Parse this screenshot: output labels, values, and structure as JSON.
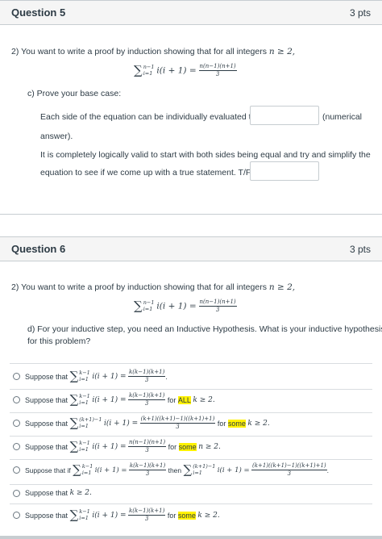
{
  "q5": {
    "title": "Question 5",
    "points": "3 pts",
    "prompt": "2) You want to write a proof by induction showing that for all integers",
    "prompt_cond": "n ≥ 2,",
    "formula_sum_upper": "n−1",
    "formula_sum_lower": "i=1",
    "formula_body": "i(i + 1) =",
    "formula_num": "n(n−1)(n+1)",
    "formula_den": "3",
    "part_label": "c) Prove your base case:",
    "line1": "Each side of the equation can be individually evaluated to",
    "line1_suffix": "(numerical",
    "line1_cont": "answer).",
    "line2": "It is completely logically valid to start with both sides being equal and try and simplify the",
    "line2_cont": "equation to see if we come up with a true statement.  T/F"
  },
  "q6": {
    "title": "Question 6",
    "points": "3 pts",
    "prompt": "2) You want to write a proof by induction showing that for all integers",
    "prompt_cond": "n ≥ 2,",
    "formula_sum_upper": "n−1",
    "formula_sum_lower": "i=1",
    "formula_body": "i(i + 1) =",
    "formula_num": "n(n−1)(n+1)",
    "formula_den": "3",
    "part_label": "d) For your inductive step, you need an Inductive Hypothesis.  What is your inductive hypothesis",
    "part_label_cont": "for this problem?",
    "options": [
      {
        "prefix": "Suppose that",
        "upper": "k−1",
        "lower": "i=1",
        "body": "i(i + 1) =",
        "num": "k(k−1)(k+1)",
        "den": "3",
        "tail": "."
      },
      {
        "prefix": "Suppose that",
        "upper": "k−1",
        "lower": "i=1",
        "body": "i(i + 1) =",
        "num": "k(k−1)(k+1)",
        "den": "3",
        "tail_pre": "for",
        "tail_hl": "ALL",
        "tail_post": "k ≥ 2."
      },
      {
        "prefix": "Suppose that",
        "upper": "(k+1)−1",
        "lower": "i=1",
        "body": "i(i + 1) =",
        "num": "(k+1)((k+1)−1)((k+1)+1)",
        "den": "3",
        "tail_pre": "for",
        "tail_hl": "some",
        "tail_post": "k ≥ 2."
      },
      {
        "prefix": "Suppose that",
        "upper": "k−1",
        "lower": "i=1",
        "body": "i(i + 1) =",
        "num": "n(n−1)(n+1)",
        "den": "3",
        "tail_pre": "for",
        "tail_hl": "some",
        "tail_post": "n ≥ 2."
      },
      {
        "prefix": "Suppose that if",
        "upper": "k−1",
        "lower": "i=1",
        "body": "i(i + 1) =",
        "num": "k(k−1)(k+1)",
        "den": "3",
        "mid": "then",
        "upper2": "(k+1)−1",
        "lower2": "i=1",
        "body2": "i(i + 1) =",
        "num2": "(k+1)((k+1)−1)((k+1)+1)",
        "den2": "3",
        "tail": "."
      },
      {
        "prefix": "Suppose that",
        "plain": "k ≥ 2."
      },
      {
        "prefix": "Suppose that",
        "upper": "k−1",
        "lower": "i=1",
        "body": "i(i + 1) =",
        "num": "k(k−1)(k+1)",
        "den": "3",
        "tail_pre": "for",
        "tail_hl": "some",
        "tail_post": "k ≥ 2."
      }
    ]
  },
  "colors": {
    "highlight": "#fff200",
    "border": "#c7cdd1",
    "header_bg": "#f5f5f5",
    "text": "#2d3b45"
  }
}
